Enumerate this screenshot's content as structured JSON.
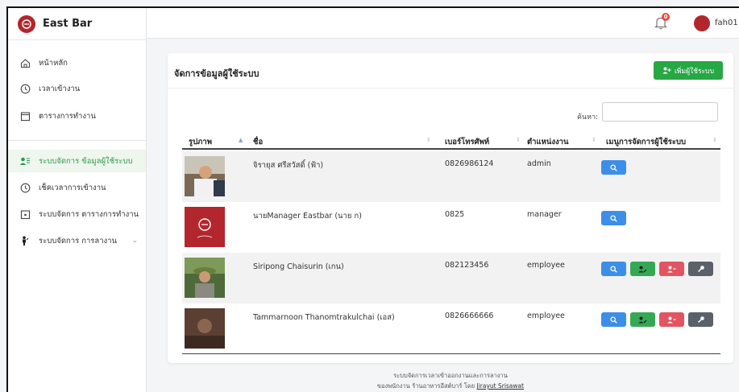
{
  "sidebar": {
    "brand": "East Bar",
    "items": [
      {
        "label": "หน้าหลัก",
        "icon": "home-icon"
      },
      {
        "label": "เวลาเข้างาน",
        "icon": "clock-icon"
      },
      {
        "label": "ตารางการทำงาน",
        "icon": "calendar-icon"
      },
      {
        "label": "ระบบจัดการ ข้อมูลผู้ใช้ระบบ",
        "icon": "users-icon",
        "active": true
      },
      {
        "label": "เช็คเวลาการเข้างาน",
        "icon": "clock-icon"
      },
      {
        "label": "ระบบจัดการ ตารางการทำงาน",
        "icon": "calendar-plus-icon"
      },
      {
        "label": "ระบบจัดการ การลางาน",
        "icon": "person-icon"
      }
    ]
  },
  "topbar": {
    "notification_count": "0",
    "username": "fah01"
  },
  "card": {
    "title": "จัดการข้อมูลผู้ใช้ระบบ",
    "add_button": "เพิ่มผู้ใช้ระบบ",
    "search_label": "ค้นหา:",
    "search_value": ""
  },
  "table": {
    "headers": [
      "รูปภาพ",
      "ชื่อ",
      "เบอร์โทรศัพท์",
      "ตำแหน่งงาน",
      "เมนูการจัดการผู้ใช้ระบบ"
    ],
    "rows": [
      {
        "name": "จิรายุส ศรีสวัสดิ์ (ฟ้า)",
        "phone": "0826986124",
        "position": "admin"
      },
      {
        "name": "นายManager Eastbar (นาย ก)",
        "phone": "0825",
        "position": "manager"
      },
      {
        "name": "Siripong Chaisurin (เกน)",
        "phone": "082123456",
        "position": "employee"
      },
      {
        "name": "Tammarnoon Thanomtrakulchai (เอส)",
        "phone": "0826666666",
        "position": "employee"
      }
    ]
  },
  "footer": {
    "line1": "ระบบจัดการเวลาเข้าออกงานและการลางาน",
    "line2_prefix": "ของพนักงาน ร้านอาหารอีสต์บาร์ โดย",
    "author": "Jirayut Srisawat"
  },
  "colors": {
    "brand": "#b3262d",
    "accent_green": "#28a745",
    "view_blue": "#3d8ee8",
    "danger_red": "#e05561",
    "dark_gray": "#5a6169"
  }
}
